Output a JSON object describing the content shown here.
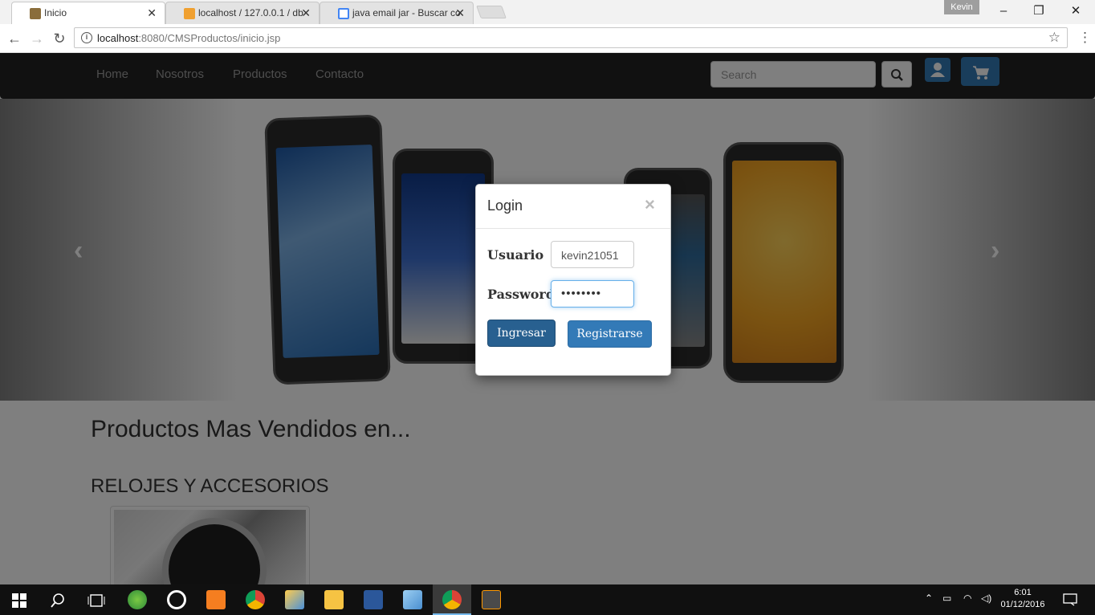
{
  "browser": {
    "tabs": [
      {
        "title": "Inicio",
        "active": true
      },
      {
        "title": "localhost / 127.0.0.1 / db",
        "active": false
      },
      {
        "title": "java email jar - Buscar co",
        "active": false
      }
    ],
    "profile": "Kevin",
    "url_host": "localhost",
    "url_path": ":8080/CMSProductos/inicio.jsp"
  },
  "navbar": {
    "links": [
      "Home",
      "Nosotros",
      "Productos",
      "Contacto"
    ],
    "search_placeholder": "Search"
  },
  "content": {
    "heading": "Productos Mas Vendidos en...",
    "category": "RELOJES Y ACCESORIOS"
  },
  "modal": {
    "title": "Login",
    "close": "×",
    "user_label": "Usuario",
    "user_value": "kevin21051",
    "password_label": "Password",
    "password_value": "••••••••",
    "login_button": "Ingresar",
    "register_button": "Registrarse"
  },
  "taskbar": {
    "time": "6:01",
    "date": "01/12/2016"
  },
  "colors": {
    "navbar": "#222222",
    "primary": "#337ab7",
    "taskbar": "#101010"
  }
}
